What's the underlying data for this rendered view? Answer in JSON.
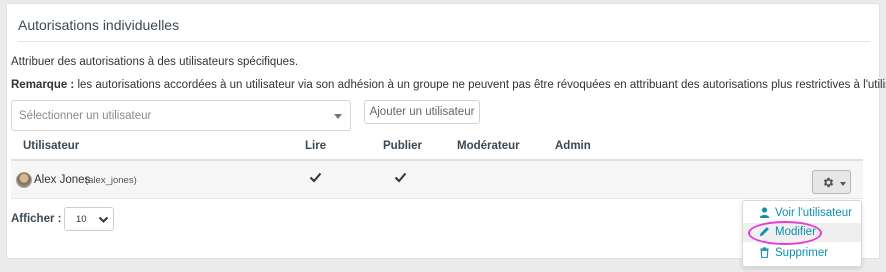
{
  "panel": {
    "title": "Autorisations individuelles",
    "intro": "Attribuer des autorisations à des utilisateurs spécifiques.",
    "remark_label": "Remarque :",
    "remark_text": " les autorisations accordées à un utilisateur via son adhésion à un groupe ne peuvent pas être révoquées en attribuant des autorisations plus restrictives à l'utilisateur."
  },
  "user_select": {
    "placeholder": "Sélectionner un utilisateur"
  },
  "add_button": {
    "label": "Ajouter un utilisateur"
  },
  "table": {
    "headers": [
      "Utilisateur",
      "Lire",
      "Publier",
      "Modérateur",
      "Admin"
    ],
    "rows": [
      {
        "name": "Alex Jones",
        "handle": "(alex_jones)",
        "read": true,
        "publish": true,
        "moderator": false,
        "admin": false
      }
    ]
  },
  "pagination": {
    "label": "Afficher :",
    "value": "10"
  },
  "actions_menu": {
    "items": [
      {
        "label": "Voir l'utilisateur",
        "icon": "user-icon"
      },
      {
        "label": "Modifier",
        "icon": "pencil-icon"
      },
      {
        "label": "Supprimer",
        "icon": "trash-icon"
      }
    ]
  },
  "colors": {
    "accent": "#0e8fae",
    "highlight": "#e83ad8",
    "header_text": "#3b4a55"
  }
}
